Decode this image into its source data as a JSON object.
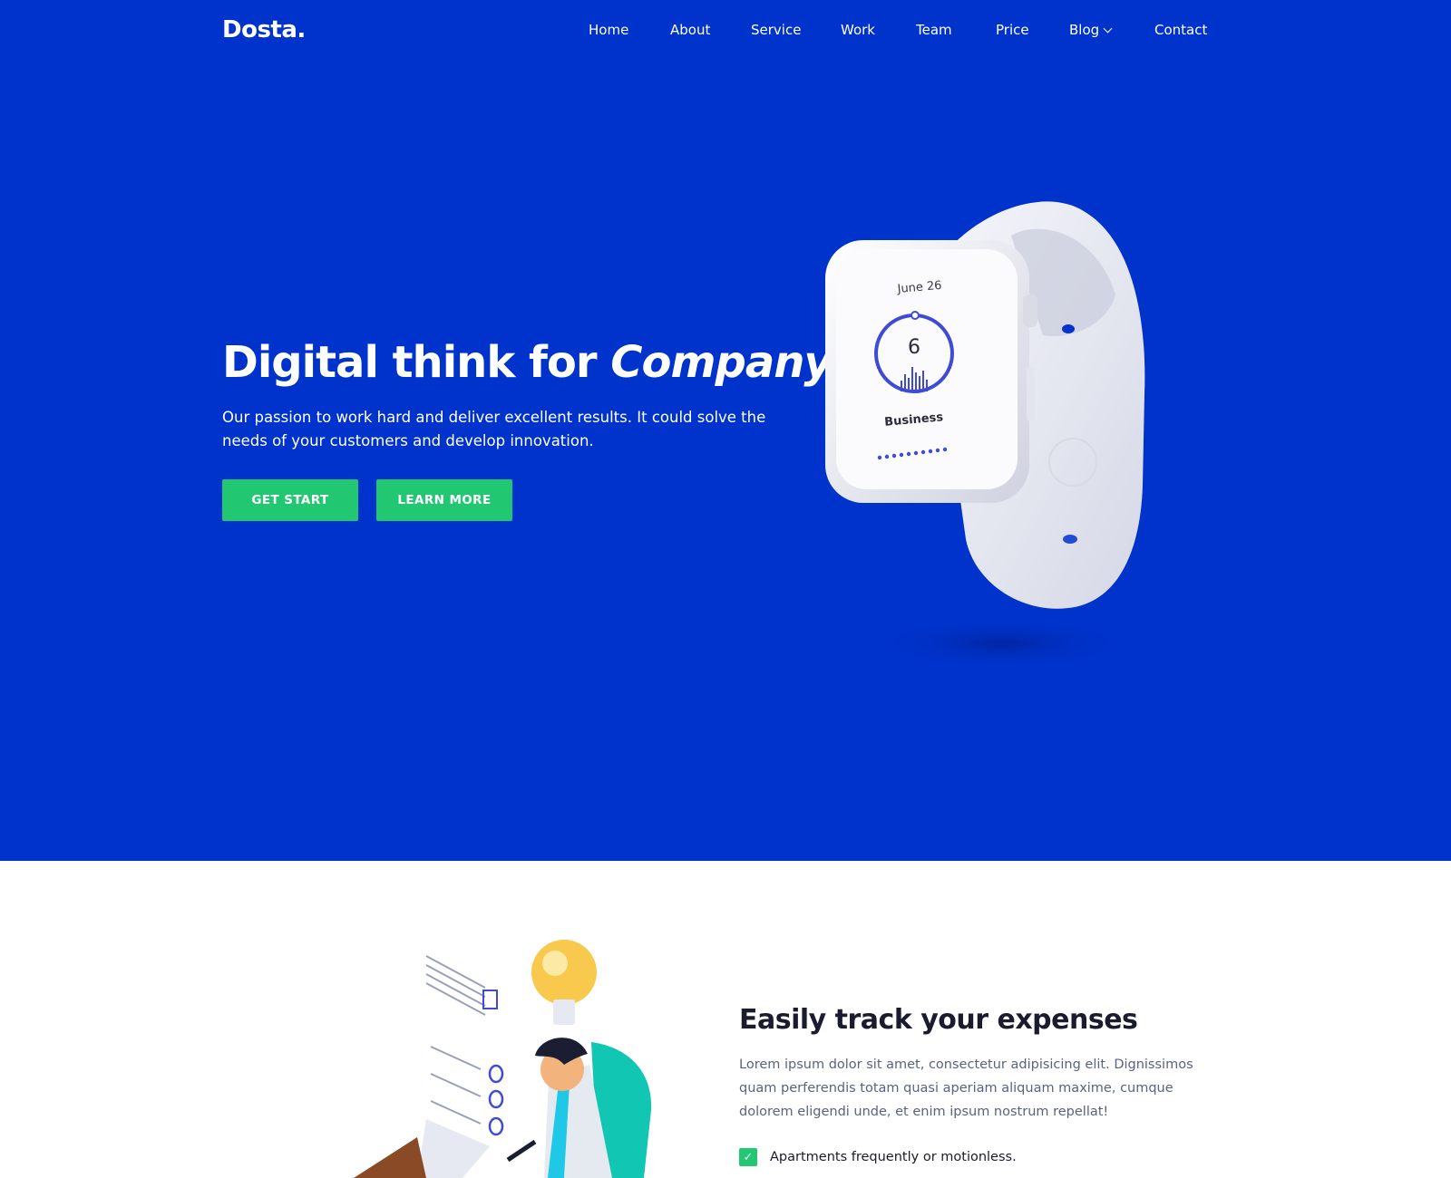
{
  "brand": {
    "logo": "Dosta."
  },
  "nav": {
    "items": [
      {
        "label": "Home"
      },
      {
        "label": "About"
      },
      {
        "label": "Service"
      },
      {
        "label": "Work"
      },
      {
        "label": "Team"
      },
      {
        "label": "Price"
      },
      {
        "label": "Blog",
        "has_dropdown": true
      },
      {
        "label": "Contact"
      }
    ]
  },
  "hero": {
    "title_plain": "Digital think for",
    "title_emphasis": "Company.",
    "description": "Our passion to work hard and deliver excellent results. It could solve the needs of your customers and develop innovation.",
    "primary_button": "GET START",
    "secondary_button": "LEARN MORE",
    "watch": {
      "date": "June 26",
      "value": "6",
      "label": "Business"
    }
  },
  "features": {
    "title": "Easily track your expenses",
    "description": "Lorem ipsum dolor sit amet, consectetur adipisicing elit. Dignissimos quam perferendis totam quasi aperiam aliquam maxime, cumque dolorem eligendi unde, et enim ipsum nostrum repellat!",
    "checklist": [
      {
        "text": "Apartments frequently or motionless."
      }
    ]
  },
  "colors": {
    "hero_bg": "#0033cc",
    "accent_green": "#22c771",
    "heading_dark": "#1b1b2f",
    "body_text": "#5a6280"
  },
  "icons": {
    "dropdown": "chevron-down-icon",
    "check": "checkmark-icon"
  }
}
